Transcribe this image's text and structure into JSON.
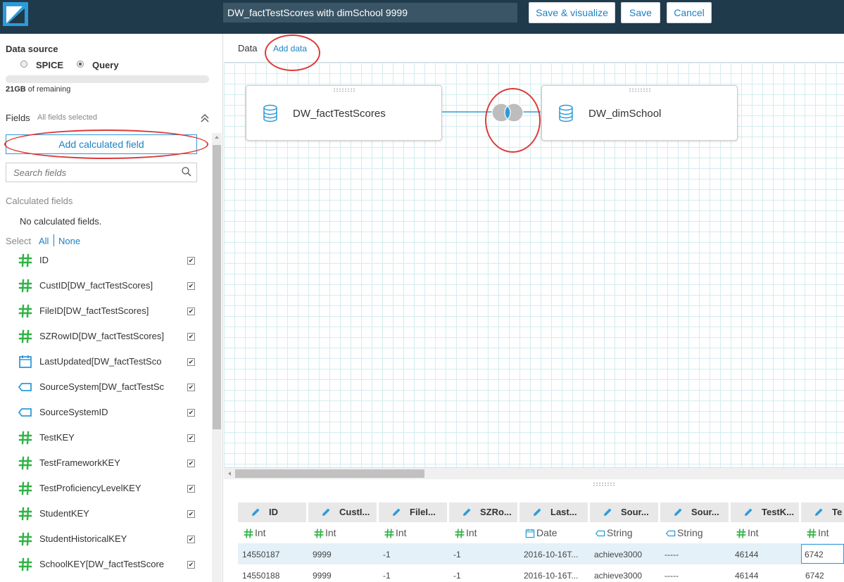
{
  "header": {
    "dataset_title": "DW_factTestScores with dimSchool 9999",
    "save_visualize_label": "Save & visualize",
    "save_label": "Save",
    "cancel_label": "Cancel"
  },
  "sidebar": {
    "data_source_label": "Data source",
    "spice_label": "SPICE",
    "query_label": "Query",
    "selected_source": "Query",
    "storage_amount": "21GB",
    "storage_suffix": " of remaining",
    "fields_label": "Fields",
    "fields_status": "All fields selected",
    "add_calculated_label": "Add calculated field",
    "search_placeholder": "Search fields",
    "calculated_fields_label": "Calculated fields",
    "no_calculated_text": "No calculated fields.",
    "select_label": "Select",
    "select_all": "All",
    "select_none": "None",
    "fields": [
      {
        "label": "ID",
        "type": "hash-icon"
      },
      {
        "label": "CustID[DW_factTestScores]",
        "type": "hash-icon"
      },
      {
        "label": "FileID[DW_factTestScores]",
        "type": "hash-icon"
      },
      {
        "label": "SZRowID[DW_factTestScores]",
        "type": "hash-icon"
      },
      {
        "label": "LastUpdated[DW_factTestSco",
        "type": "calendar-icon"
      },
      {
        "label": "SourceSystem[DW_factTestSc",
        "type": "tag-icon"
      },
      {
        "label": "SourceSystemID",
        "type": "tag-icon"
      },
      {
        "label": "TestKEY",
        "type": "hash-icon"
      },
      {
        "label": "TestFrameworkKEY",
        "type": "hash-icon"
      },
      {
        "label": "TestProficiencyLevelKEY",
        "type": "hash-icon"
      },
      {
        "label": "StudentKEY",
        "type": "hash-icon"
      },
      {
        "label": "StudentHistoricalKEY",
        "type": "hash-icon"
      },
      {
        "label": "SchoolKEY[DW_factTestScore",
        "type": "hash-icon"
      }
    ]
  },
  "canvas": {
    "tab_data": "Data",
    "tab_add_data": "Add data",
    "left_table": "DW_factTestScores",
    "right_table": "DW_dimSchool"
  },
  "preview": {
    "columns": [
      {
        "header": "ID",
        "type": "Int",
        "type_icon": "hash-icon"
      },
      {
        "header": "CustI...",
        "type": "Int",
        "type_icon": "hash-icon"
      },
      {
        "header": "FileI...",
        "type": "Int",
        "type_icon": "hash-icon"
      },
      {
        "header": "SZRo...",
        "type": "Int",
        "type_icon": "hash-icon"
      },
      {
        "header": "Last...",
        "type": "Date",
        "type_icon": "calendar-icon"
      },
      {
        "header": "Sour...",
        "type": "String",
        "type_icon": "tag-icon"
      },
      {
        "header": "Sour...",
        "type": "String",
        "type_icon": "tag-icon"
      },
      {
        "header": "TestK...",
        "type": "Int",
        "type_icon": "hash-icon"
      },
      {
        "header": "Te",
        "type": "Int",
        "type_icon": "hash-icon"
      }
    ],
    "rows": [
      [
        "14550187",
        "9999",
        "-1",
        "-1",
        "2016-10-16T...",
        "achieve3000",
        "-----",
        "46144",
        "6742"
      ],
      [
        "14550188",
        "9999",
        "-1",
        "-1",
        "2016-10-16T...",
        "achieve3000",
        "-----",
        "46144",
        "6742"
      ]
    ]
  },
  "colors": {
    "topbar": "#1f3a4b",
    "accent": "#1a82c4",
    "hash_icon": "#2fb344",
    "annotation": "#e03a3a"
  }
}
